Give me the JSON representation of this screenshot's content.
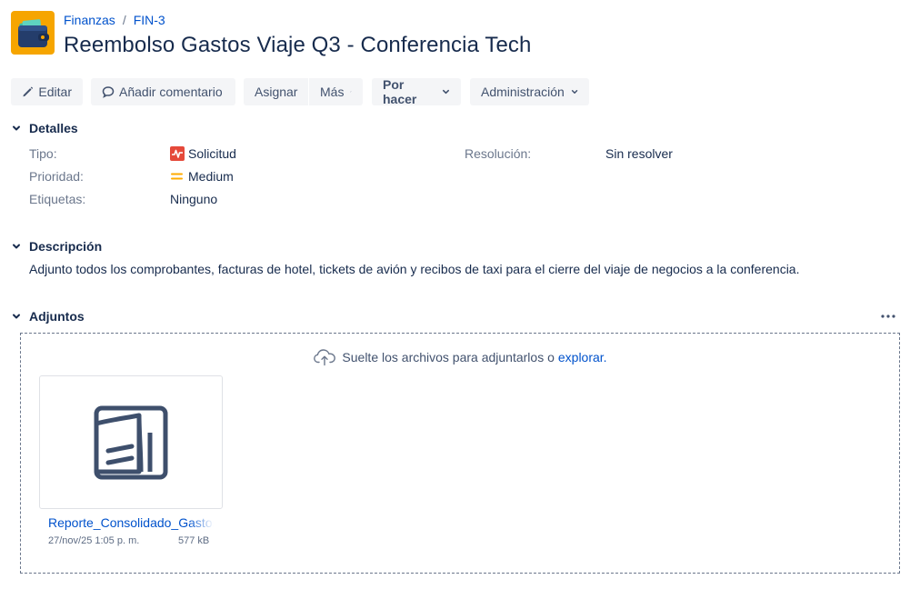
{
  "breadcrumb": {
    "project": "Finanzas",
    "separator": "/",
    "issue_key": "FIN-3"
  },
  "issue": {
    "title": "Reembolso Gastos Viaje Q3 - Conferencia Tech"
  },
  "toolbar": {
    "edit": "Editar",
    "comment": "Añadir comentario",
    "assign": "Asignar",
    "more": "Más",
    "status": "Por hacer",
    "admin": "Administración"
  },
  "details": {
    "heading": "Detalles",
    "type_label": "Tipo:",
    "type_value": "Solicitud",
    "priority_label": "Prioridad:",
    "priority_value": "Medium",
    "labels_label": "Etiquetas:",
    "labels_value": "Ninguno",
    "resolution_label": "Resolución:",
    "resolution_value": "Sin resolver"
  },
  "description": {
    "heading": "Descripción",
    "text": "Adjunto todos los comprobantes, facturas de hotel, tickets de avión y recibos de taxi para el cierre del viaje de negocios a la conferencia."
  },
  "attachments": {
    "heading": "Adjuntos",
    "drop_text": "Suelte los archivos para adjuntarlos o",
    "drop_link": "explorar.",
    "files": [
      {
        "name": "Reporte_Consolidado_Gastos",
        "date": "27/nov/25 1:05 p. m.",
        "size": "577 kB"
      }
    ]
  },
  "colors": {
    "link": "#0052cc",
    "button_bg": "#f4f5f7",
    "type_icon": "#e5493a",
    "priority_icon": "#ffab00",
    "avatar_bg": "#f6a500"
  },
  "icons": [
    "wallet-icon",
    "pencil-icon",
    "comment-icon",
    "chevron-down-icon",
    "request-icon",
    "priority-medium-icon",
    "more-icon",
    "cloud-upload-icon",
    "document-icon"
  ]
}
